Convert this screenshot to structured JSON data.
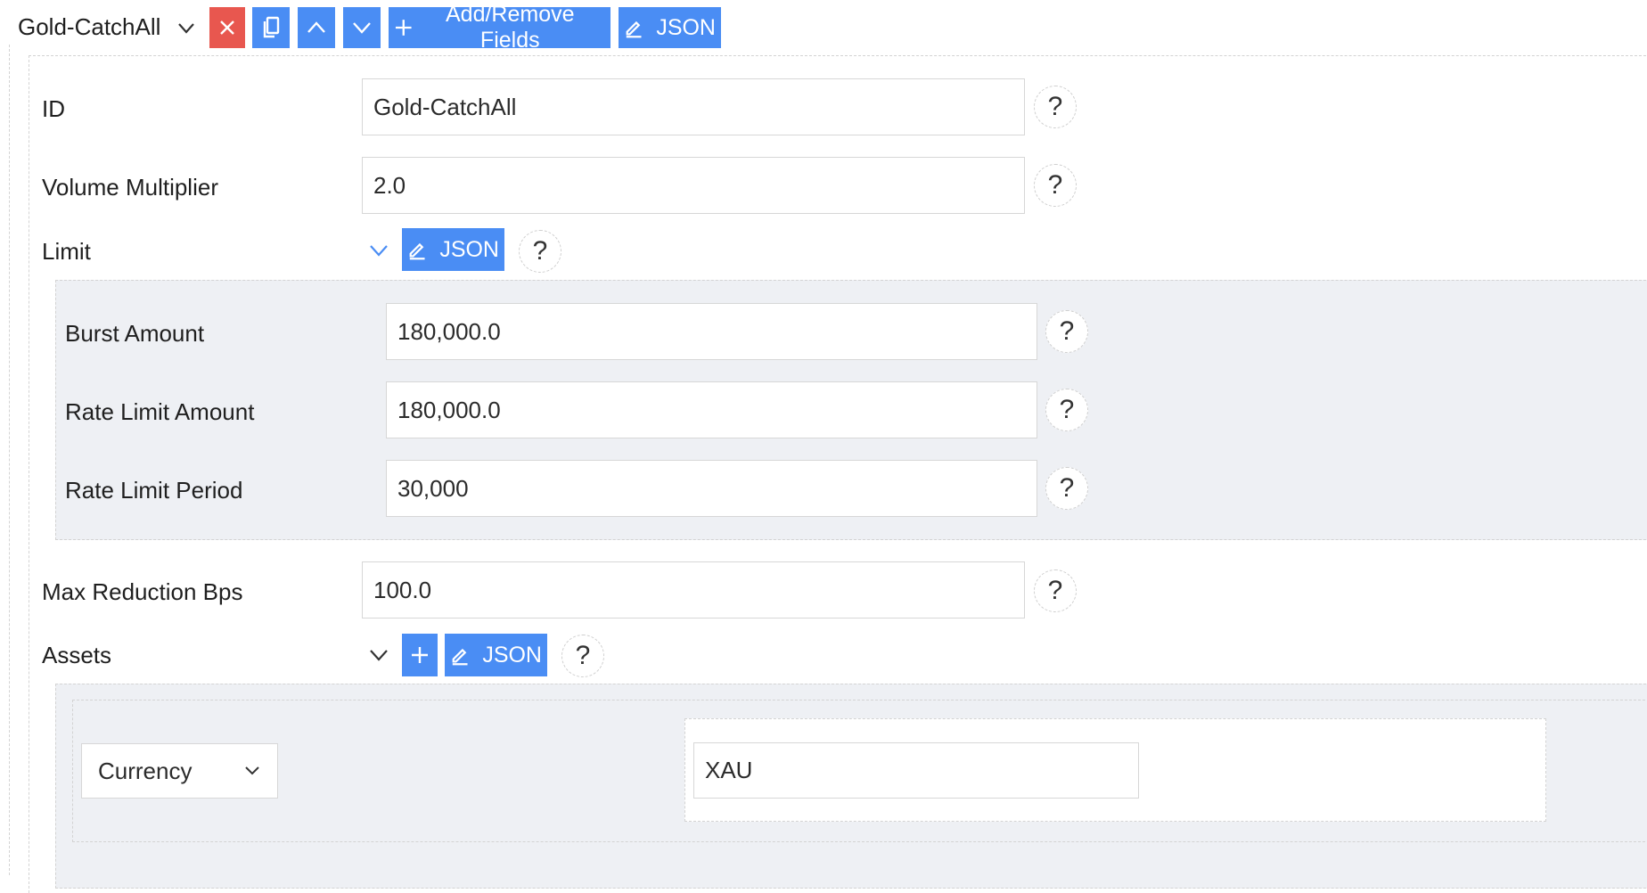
{
  "header": {
    "title": "Gold-CatchAll",
    "add_remove_label": "Add/Remove Fields",
    "json_label": "JSON"
  },
  "fields": {
    "id": {
      "label": "ID",
      "value": "Gold-CatchAll"
    },
    "volume_multiplier": {
      "label": "Volume Multiplier",
      "value": "2.0"
    },
    "limit": {
      "label": "Limit",
      "json_label": "JSON",
      "burst_amount": {
        "label": "Burst Amount",
        "value": "180,000.0"
      },
      "rate_limit_amount": {
        "label": "Rate Limit Amount",
        "value": "180,000.0"
      },
      "rate_limit_period": {
        "label": "Rate Limit Period",
        "value": "30,000"
      }
    },
    "max_reduction_bps": {
      "label": "Max Reduction Bps",
      "value": "100.0"
    },
    "assets": {
      "label": "Assets",
      "json_label": "JSON",
      "items": [
        {
          "type_selected": "Currency",
          "value": "XAU"
        }
      ]
    }
  },
  "help_glyph": "?",
  "colors": {
    "primary": "#4a8df4",
    "danger": "#e8574f",
    "panel_bg": "#eef0f4",
    "border": "#d7d7d7"
  },
  "icons": [
    "close-icon",
    "copy-icon",
    "chevron-up-icon",
    "chevron-down-icon",
    "plus-icon",
    "edit-icon"
  ]
}
